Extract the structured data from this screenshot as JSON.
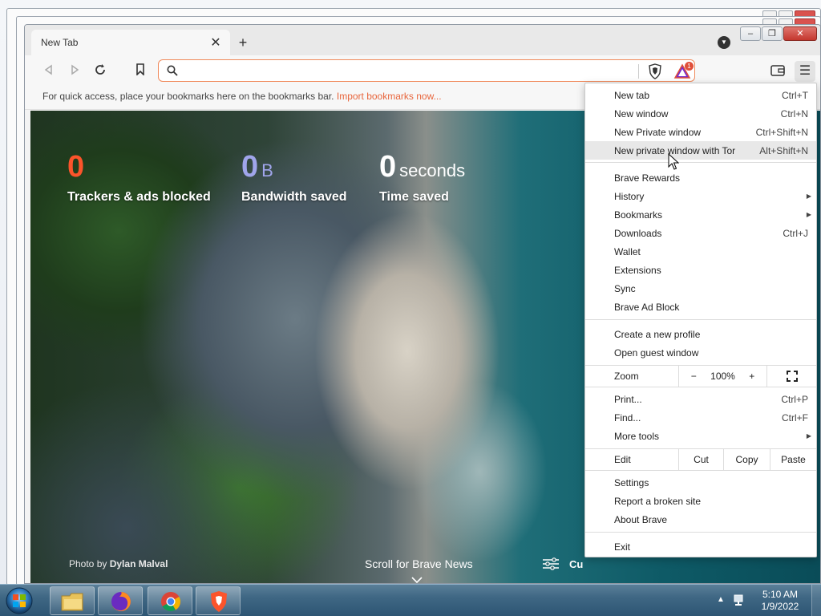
{
  "tab": {
    "title": "New Tab"
  },
  "omnibox": {
    "value": "",
    "placeholder": "",
    "rewards_badge": "1"
  },
  "bookmarks_bar": {
    "message": "For quick access, place your bookmarks here on the bookmarks bar.",
    "import_link": "Import bookmarks now..."
  },
  "stats": [
    {
      "value": "0",
      "unit": "",
      "label": "Trackers & ads blocked",
      "color": "#fb542b"
    },
    {
      "value": "0",
      "unit": "B",
      "label": "Bandwidth saved",
      "color": "#a0a5eb"
    },
    {
      "value": "0",
      "unit": "seconds",
      "label": "Time saved",
      "color": "#ffffff"
    }
  ],
  "photo_credit": {
    "prefix": "Photo by",
    "name": "Dylan Malval"
  },
  "brave_news": {
    "label": "Scroll for Brave News"
  },
  "customize": {
    "label": "Cu"
  },
  "menu": {
    "items": [
      {
        "label": "New tab",
        "shortcut": "Ctrl+T"
      },
      {
        "label": "New window",
        "shortcut": "Ctrl+N"
      },
      {
        "label": "New Private window",
        "shortcut": "Ctrl+Shift+N"
      },
      {
        "label": "New private window with Tor",
        "shortcut": "Alt+Shift+N"
      },
      {
        "label": "Brave Rewards",
        "shortcut": ""
      },
      {
        "label": "History",
        "shortcut": ""
      },
      {
        "label": "Bookmarks",
        "shortcut": ""
      },
      {
        "label": "Downloads",
        "shortcut": "Ctrl+J"
      },
      {
        "label": "Wallet",
        "shortcut": ""
      },
      {
        "label": "Extensions",
        "shortcut": ""
      },
      {
        "label": "Sync",
        "shortcut": ""
      },
      {
        "label": "Brave Ad Block",
        "shortcut": ""
      },
      {
        "label": "Create a new profile",
        "shortcut": ""
      },
      {
        "label": "Open guest window",
        "shortcut": ""
      },
      {
        "label": "Print...",
        "shortcut": "Ctrl+P"
      },
      {
        "label": "Find...",
        "shortcut": "Ctrl+F"
      },
      {
        "label": "More tools",
        "shortcut": ""
      },
      {
        "label": "Settings",
        "shortcut": ""
      },
      {
        "label": "Report a broken site",
        "shortcut": ""
      },
      {
        "label": "About Brave",
        "shortcut": ""
      },
      {
        "label": "Exit",
        "shortcut": ""
      }
    ],
    "zoom": {
      "label": "Zoom",
      "minus": "−",
      "value": "100%",
      "plus": "+"
    },
    "edit": {
      "label": "Edit",
      "cut": "Cut",
      "copy": "Copy",
      "paste": "Paste"
    },
    "hovered_item": "New private window with Tor"
  },
  "taskbar": {
    "apps": [
      "windows-explorer",
      "firefox",
      "chrome",
      "brave"
    ],
    "time": "5:10 AM",
    "date": "1/9/2022"
  },
  "colors": {
    "brave_orange": "#fb542b",
    "omnibox_border": "#f08a5c",
    "import_link": "#e8663d"
  }
}
